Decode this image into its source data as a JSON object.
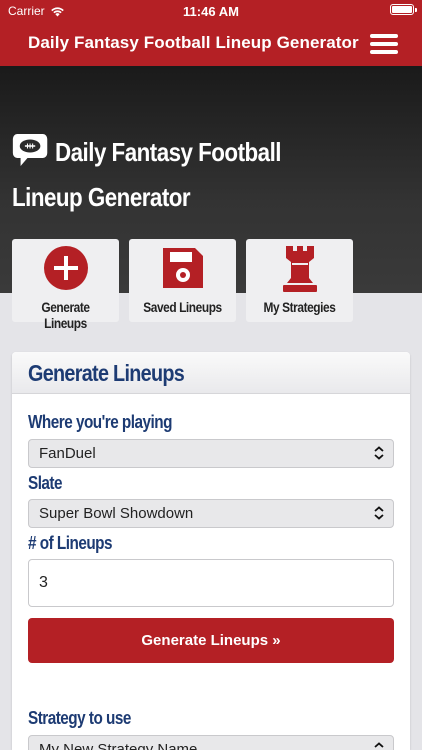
{
  "status_bar": {
    "carrier": "Carrier",
    "time": "11:46 AM"
  },
  "nav": {
    "title": "Daily Fantasy Football Lineup Generator",
    "menu_icon": "hamburger-menu-icon"
  },
  "hero": {
    "title": "Daily Fantasy Football Lineup Generator",
    "icon": "football-chat-icon",
    "tiles": [
      {
        "label": "Generate Lineups",
        "icon": "plus-circle-icon"
      },
      {
        "label": "Saved Lineups",
        "icon": "floppy-disk-icon"
      },
      {
        "label": "My Strategies",
        "icon": "chess-rook-icon"
      }
    ]
  },
  "form": {
    "title": "Generate Lineups",
    "where_label": "Where you're playing",
    "where_value": "FanDuel",
    "slate_label": "Slate",
    "slate_value": "Super Bowl Showdown",
    "lineups_label": "# of Lineups",
    "lineups_value": "3",
    "generate_button": "Generate Lineups »",
    "strategy_label": "Strategy to use",
    "strategy_value": "My New Strategy Name"
  },
  "colors": {
    "brand_red": "#b42025",
    "heading_blue": "#1d3b73",
    "hero_dark": "#2a2a2a"
  }
}
